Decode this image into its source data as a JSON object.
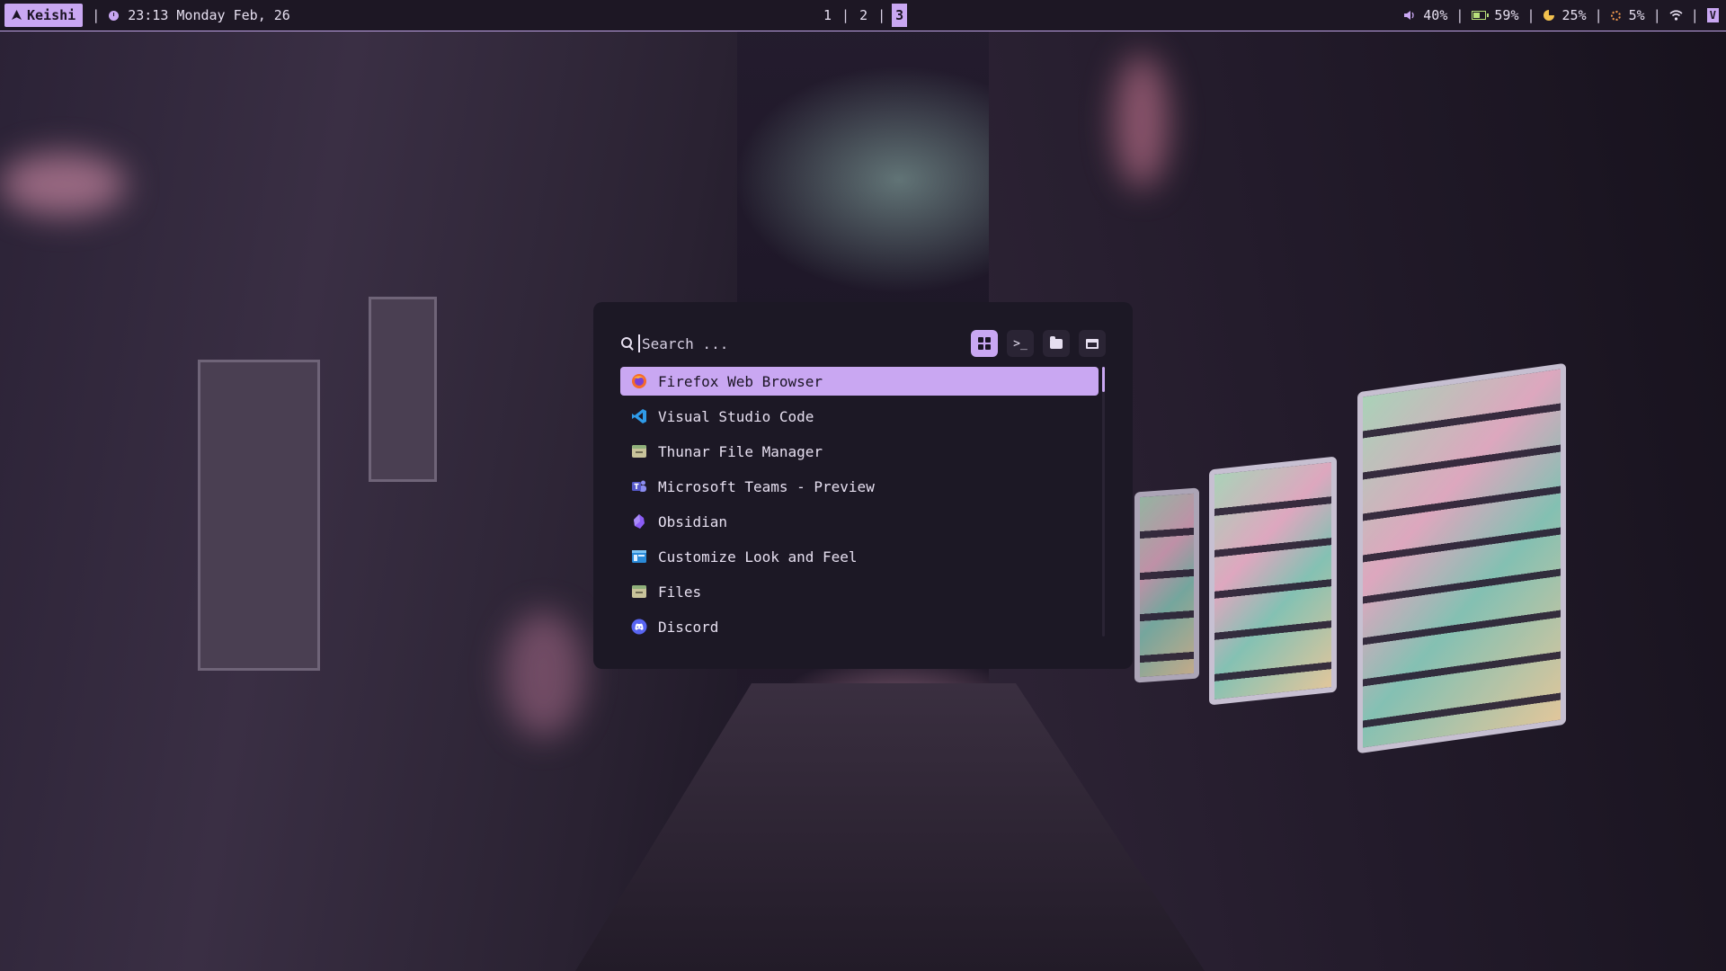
{
  "topbar": {
    "user": "Keishi",
    "separator": "|",
    "datetime": "23:13 Monday Feb, 26",
    "workspaces": [
      "1",
      "2",
      "3"
    ],
    "active_workspace": "3",
    "volume": "40%",
    "battery": "59%",
    "cpu": "25%",
    "brightness": "5%",
    "end_badge": "V"
  },
  "launcher": {
    "search_placeholder": "Search ...",
    "modes": [
      {
        "name": "apps",
        "icon": "grid-icon",
        "active": true
      },
      {
        "name": "run",
        "icon": "terminal-icon",
        "label": ">_"
      },
      {
        "name": "files",
        "icon": "folder-icon"
      },
      {
        "name": "windows",
        "icon": "window-icon"
      }
    ],
    "apps": [
      {
        "label": "Firefox Web Browser",
        "icon": "firefox-icon",
        "selected": true
      },
      {
        "label": "Visual Studio Code",
        "icon": "vscode-icon"
      },
      {
        "label": "Thunar File Manager",
        "icon": "file-manager-icon"
      },
      {
        "label": "Microsoft Teams - Preview",
        "icon": "teams-icon"
      },
      {
        "label": "Obsidian",
        "icon": "obsidian-icon"
      },
      {
        "label": "Customize Look and Feel",
        "icon": "appearance-icon"
      },
      {
        "label": "Files",
        "icon": "files-icon"
      },
      {
        "label": "Discord",
        "icon": "discord-icon"
      }
    ]
  },
  "colors": {
    "accent": "#c9a7f2",
    "panel": "#1c1825",
    "text": "#e6dff0"
  }
}
